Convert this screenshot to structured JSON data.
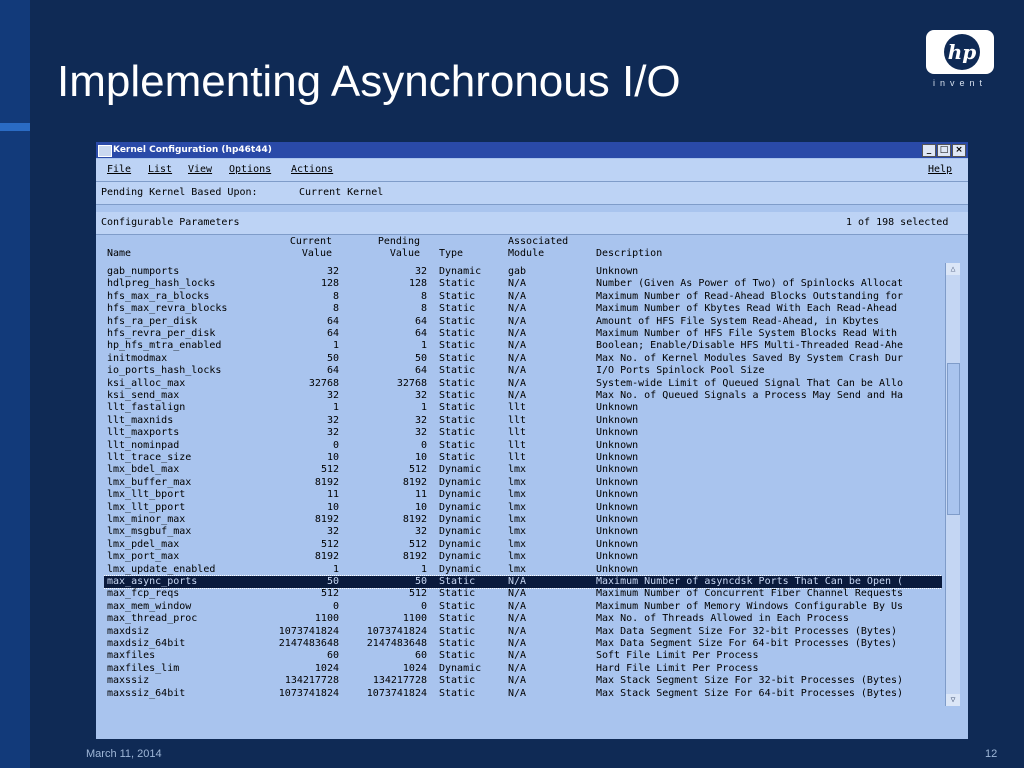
{
  "slide": {
    "title": "Implementing Asynchronous I/O",
    "date": "March 11, 2014",
    "page": "12",
    "logo_letters": "hp",
    "logo_tagline": "invent"
  },
  "window": {
    "title": "Kernel Configuration (hp46t44)",
    "controls": [
      "_",
      "□",
      "×"
    ],
    "menu": [
      "File",
      "List",
      "View",
      "Options",
      "Actions"
    ],
    "help": "Help",
    "pending_label": "Pending Kernel Based Upon:",
    "pending_value": "Current Kernel",
    "section_label": "Configurable Parameters",
    "selection_status": "1 of 198 selected",
    "columns": {
      "name": "Name",
      "current_1": "Current",
      "current_2": "Value",
      "pending_1": "Pending",
      "pending_2": "Value",
      "type": "Type",
      "module_1": "Associated",
      "module_2": "Module",
      "description": "Description"
    },
    "rows": [
      {
        "name": "gab_numports",
        "current": "32",
        "pending": "32",
        "type": "Dynamic",
        "module": "gab",
        "description": "Unknown"
      },
      {
        "name": "hdlpreg_hash_locks",
        "current": "128",
        "pending": "128",
        "type": "Static",
        "module": "N/A",
        "description": "Number (Given As Power of Two) of Spinlocks Allocat"
      },
      {
        "name": "hfs_max_ra_blocks",
        "current": "8",
        "pending": "8",
        "type": "Static",
        "module": "N/A",
        "description": "Maximum Number of Read-Ahead Blocks Outstanding for"
      },
      {
        "name": "hfs_max_revra_blocks",
        "current": "8",
        "pending": "8",
        "type": "Static",
        "module": "N/A",
        "description": "Maximum Number of Kbytes Read With Each Read-Ahead"
      },
      {
        "name": "hfs_ra_per_disk",
        "current": "64",
        "pending": "64",
        "type": "Static",
        "module": "N/A",
        "description": "Amount of HFS File System Read-Ahead, in Kbytes"
      },
      {
        "name": "hfs_revra_per_disk",
        "current": "64",
        "pending": "64",
        "type": "Static",
        "module": "N/A",
        "description": "Maximum Number of HFS File System Blocks Read With"
      },
      {
        "name": "hp_hfs_mtra_enabled",
        "current": "1",
        "pending": "1",
        "type": "Static",
        "module": "N/A",
        "description": "Boolean; Enable/Disable HFS Multi-Threaded Read-Ahe"
      },
      {
        "name": "initmodmax",
        "current": "50",
        "pending": "50",
        "type": "Static",
        "module": "N/A",
        "description": "Max No. of Kernel Modules Saved By System Crash Dur"
      },
      {
        "name": "io_ports_hash_locks",
        "current": "64",
        "pending": "64",
        "type": "Static",
        "module": "N/A",
        "description": "I/O Ports Spinlock Pool Size"
      },
      {
        "name": "ksi_alloc_max",
        "current": "32768",
        "pending": "32768",
        "type": "Static",
        "module": "N/A",
        "description": "System-wide Limit of Queued Signal That Can be Allo"
      },
      {
        "name": "ksi_send_max",
        "current": "32",
        "pending": "32",
        "type": "Static",
        "module": "N/A",
        "description": "Max No. of Queued Signals a Process May Send and Ha"
      },
      {
        "name": "llt_fastalign",
        "current": "1",
        "pending": "1",
        "type": "Static",
        "module": "llt",
        "description": "Unknown"
      },
      {
        "name": "llt_maxnids",
        "current": "32",
        "pending": "32",
        "type": "Static",
        "module": "llt",
        "description": "Unknown"
      },
      {
        "name": "llt_maxports",
        "current": "32",
        "pending": "32",
        "type": "Static",
        "module": "llt",
        "description": "Unknown"
      },
      {
        "name": "llt_nominpad",
        "current": "0",
        "pending": "0",
        "type": "Static",
        "module": "llt",
        "description": "Unknown"
      },
      {
        "name": "llt_trace_size",
        "current": "10",
        "pending": "10",
        "type": "Static",
        "module": "llt",
        "description": "Unknown"
      },
      {
        "name": "lmx_bdel_max",
        "current": "512",
        "pending": "512",
        "type": "Dynamic",
        "module": "lmx",
        "description": "Unknown"
      },
      {
        "name": "lmx_buffer_max",
        "current": "8192",
        "pending": "8192",
        "type": "Dynamic",
        "module": "lmx",
        "description": "Unknown"
      },
      {
        "name": "lmx_llt_bport",
        "current": "11",
        "pending": "11",
        "type": "Dynamic",
        "module": "lmx",
        "description": "Unknown"
      },
      {
        "name": "lmx_llt_pport",
        "current": "10",
        "pending": "10",
        "type": "Dynamic",
        "module": "lmx",
        "description": "Unknown"
      },
      {
        "name": "lmx_minor_max",
        "current": "8192",
        "pending": "8192",
        "type": "Dynamic",
        "module": "lmx",
        "description": "Unknown"
      },
      {
        "name": "lmx_msgbuf_max",
        "current": "32",
        "pending": "32",
        "type": "Dynamic",
        "module": "lmx",
        "description": "Unknown"
      },
      {
        "name": "lmx_pdel_max",
        "current": "512",
        "pending": "512",
        "type": "Dynamic",
        "module": "lmx",
        "description": "Unknown"
      },
      {
        "name": "lmx_port_max",
        "current": "8192",
        "pending": "8192",
        "type": "Dynamic",
        "module": "lmx",
        "description": "Unknown"
      },
      {
        "name": "lmx_update_enabled",
        "current": "1",
        "pending": "1",
        "type": "Dynamic",
        "module": "lmx",
        "description": "Unknown"
      },
      {
        "name": "max_async_ports",
        "current": "50",
        "pending": "50",
        "type": "Static",
        "module": "N/A",
        "description": "Maximum Number of asyncdsk Ports That Can be Open (",
        "selected": true
      },
      {
        "name": "max_fcp_reqs",
        "current": "512",
        "pending": "512",
        "type": "Static",
        "module": "N/A",
        "description": "Maximum Number of Concurrent Fiber Channel Requests"
      },
      {
        "name": "max_mem_window",
        "current": "0",
        "pending": "0",
        "type": "Static",
        "module": "N/A",
        "description": "Maximum Number of Memory Windows Configurable By Us"
      },
      {
        "name": "max_thread_proc",
        "current": "1100",
        "pending": "1100",
        "type": "Static",
        "module": "N/A",
        "description": "Max No. of Threads Allowed in Each Process"
      },
      {
        "name": "maxdsiz",
        "current": "1073741824",
        "pending": "1073741824",
        "type": "Static",
        "module": "N/A",
        "description": "Max Data Segment Size For 32-bit Processes (Bytes)"
      },
      {
        "name": "maxdsiz_64bit",
        "current": "2147483648",
        "pending": "2147483648",
        "type": "Static",
        "module": "N/A",
        "description": "Max Data Segment Size For 64-bit Processes (Bytes)"
      },
      {
        "name": "maxfiles",
        "current": "60",
        "pending": "60",
        "type": "Static",
        "module": "N/A",
        "description": "Soft File Limit Per Process"
      },
      {
        "name": "maxfiles_lim",
        "current": "1024",
        "pending": "1024",
        "type": "Dynamic",
        "module": "N/A",
        "description": "Hard File Limit Per Process"
      },
      {
        "name": "maxssiz",
        "current": "134217728",
        "pending": "134217728",
        "type": "Static",
        "module": "N/A",
        "description": "Max Stack Segment Size For 32-bit Processes (Bytes)"
      },
      {
        "name": "maxssiz_64bit",
        "current": "1073741824",
        "pending": "1073741824",
        "type": "Static",
        "module": "N/A",
        "description": "Max Stack Segment Size For 64-bit Processes (Bytes)"
      }
    ],
    "scroll_up_icon": "△",
    "scroll_down_icon": "▽"
  }
}
